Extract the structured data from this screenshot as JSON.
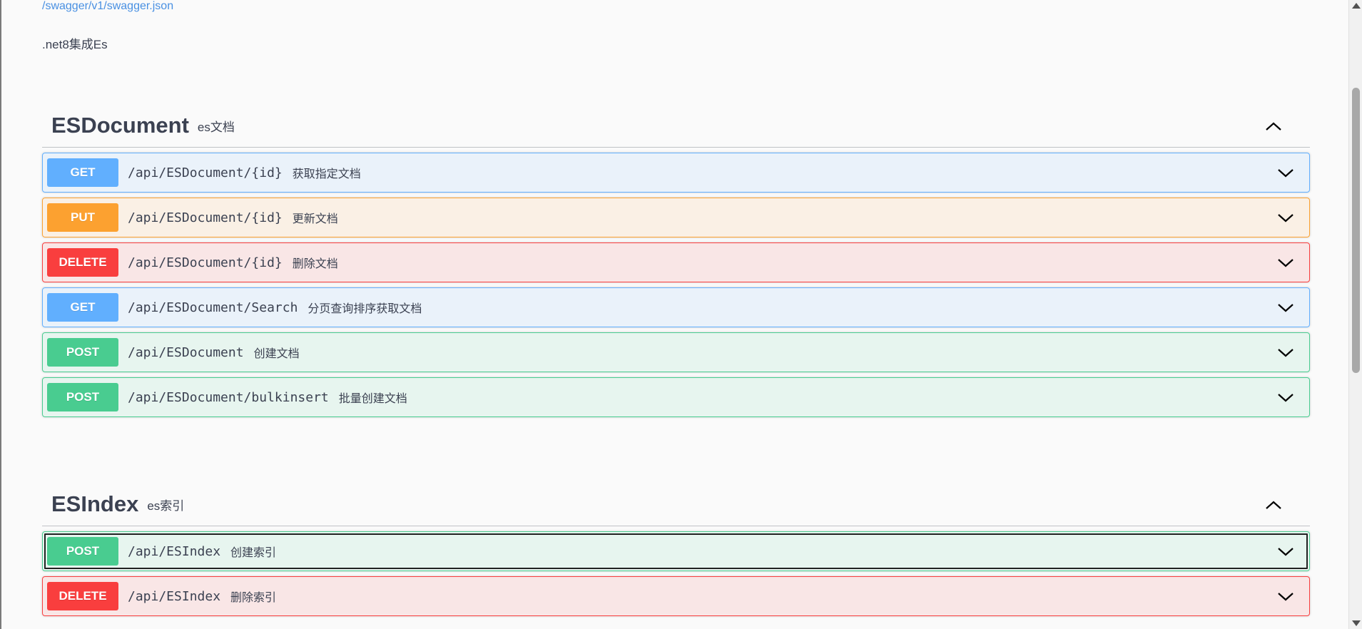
{
  "spec_link": "/swagger/v1/swagger.json",
  "description": ".net8集成Es",
  "tags": [
    {
      "name": "ESDocument",
      "description": "es文档",
      "operations": [
        {
          "method": "GET",
          "path": "/api/ESDocument/{id}",
          "summary": "获取指定文档"
        },
        {
          "method": "PUT",
          "path": "/api/ESDocument/{id}",
          "summary": "更新文档"
        },
        {
          "method": "DELETE",
          "path": "/api/ESDocument/{id}",
          "summary": "删除文档"
        },
        {
          "method": "GET",
          "path": "/api/ESDocument/Search",
          "summary": "分页查询排序获取文档"
        },
        {
          "method": "POST",
          "path": "/api/ESDocument",
          "summary": "创建文档"
        },
        {
          "method": "POST",
          "path": "/api/ESDocument/bulkinsert",
          "summary": "批量创建文档"
        }
      ]
    },
    {
      "name": "ESIndex",
      "description": "es索引",
      "operations": [
        {
          "method": "POST",
          "path": "/api/ESIndex",
          "summary": "创建索引"
        },
        {
          "method": "DELETE",
          "path": "/api/ESIndex",
          "summary": "删除索引"
        }
      ]
    }
  ],
  "colors": {
    "get": "#61affe",
    "put": "#fca130",
    "delete": "#f93e3e",
    "post": "#49cc90",
    "text": "#3b4151",
    "link": "#4990e2"
  },
  "icons": {
    "tag_toggle": "chevron-up-icon",
    "op_toggle": "chevron-down-icon"
  }
}
